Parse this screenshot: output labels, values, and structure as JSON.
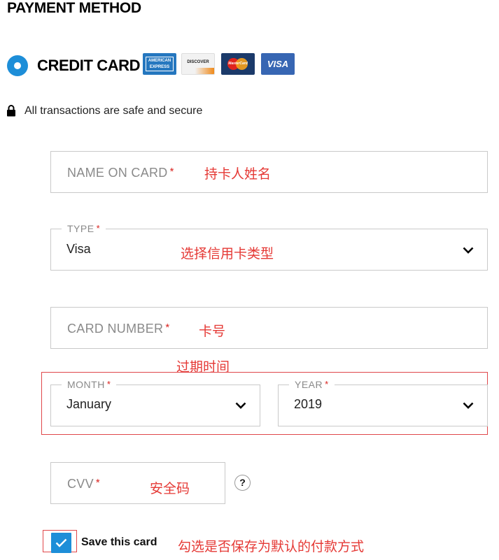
{
  "header": {
    "title": "PAYMENT METHOD"
  },
  "payment_option": {
    "label": "CREDIT CARD",
    "selected": true,
    "card_logos": [
      {
        "name": "amex",
        "text": "AMERICAN EXPRESS",
        "color": "#2577bf"
      },
      {
        "name": "discover",
        "text": "DISCOVER",
        "color": "#f08a1a"
      },
      {
        "name": "mastercard",
        "text": "MasterCard",
        "color": "#1b3a6a"
      },
      {
        "name": "visa",
        "text": "VISA",
        "color": "#3766b3"
      }
    ]
  },
  "security": {
    "icon": "lock-icon",
    "text": "All transactions are safe and secure"
  },
  "form": {
    "name_on_card": {
      "placeholder": "NAME ON CARD",
      "required": "*",
      "value": ""
    },
    "type": {
      "label": "TYPE",
      "required": "*",
      "value": "Visa"
    },
    "card_number": {
      "placeholder": "CARD NUMBER",
      "required": "*",
      "value": ""
    },
    "month": {
      "label": "MONTH",
      "required": "*",
      "value": "January"
    },
    "year": {
      "label": "YEAR",
      "required": "*",
      "value": "2019"
    },
    "cvv": {
      "placeholder": "CVV",
      "required": "*",
      "value": ""
    },
    "help": "?",
    "save_card": {
      "label": "Save this card",
      "checked": true
    }
  },
  "annotations": {
    "name_on_card": "持卡人姓名",
    "type": "选择信用卡类型",
    "card_number": "卡号",
    "expiry": "过期时间",
    "cvv": "安全码",
    "save_card": "勾选是否保存为默认的付款方式"
  },
  "colors": {
    "accent": "#1d8ed8",
    "required": "#d9231f",
    "annotation": "#e53935",
    "border": "#c9c9c9"
  }
}
